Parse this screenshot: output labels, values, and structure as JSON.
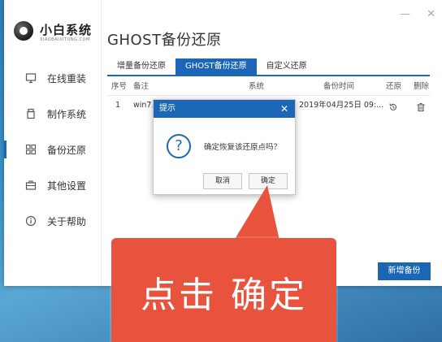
{
  "app": {
    "name": "小白系统",
    "subtitle": "XIAOBAIXITONG.COM",
    "window_controls": [
      "—",
      "✕"
    ]
  },
  "sidebar": {
    "items": [
      {
        "label": "在线重装",
        "icon": "monitor-icon"
      },
      {
        "label": "制作系统",
        "icon": "usb-drive-icon"
      },
      {
        "label": "备份还原",
        "icon": "grid-restore-icon",
        "active": true
      },
      {
        "label": "其他设置",
        "icon": "briefcase-icon"
      },
      {
        "label": "关于帮助",
        "icon": "info-icon"
      }
    ]
  },
  "main": {
    "title": "GHOST备份还原",
    "tabs": [
      {
        "label": "增量备份还原"
      },
      {
        "label": "GHOST备份还原",
        "active": true
      },
      {
        "label": "自定义还原"
      }
    ],
    "table": {
      "headers": [
        "序号",
        "备注",
        "系统",
        "备份时间",
        "还原",
        "删除"
      ],
      "rows": [
        {
          "index": "1",
          "note": "win7系",
          "system": "",
          "time": "2019年04月25日 09:..."
        }
      ]
    },
    "new_backup_label": "新增备份"
  },
  "dialog": {
    "title": "提示",
    "close": "✕",
    "message": "确定恢复该还原点吗？",
    "question_mark": "?",
    "cancel_label": "取消",
    "confirm_label": "确定"
  },
  "callout": {
    "text": "点击 确定"
  },
  "colors": {
    "accent": "#1c67b5",
    "callout": "#e8533e"
  }
}
